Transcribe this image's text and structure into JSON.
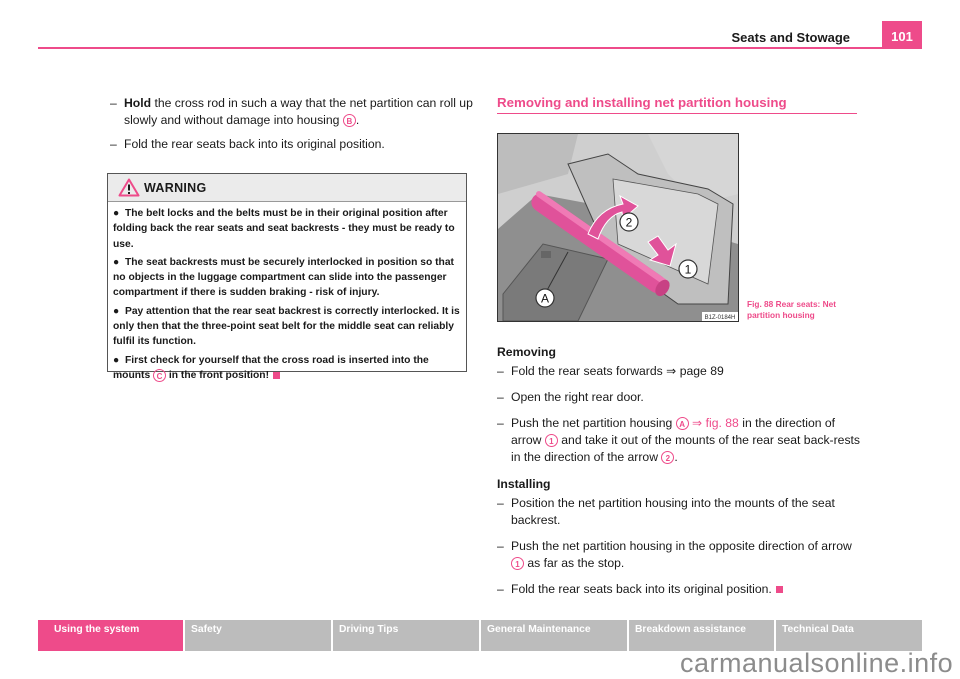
{
  "header": {
    "title": "Seats and Stowage",
    "page_number": "101"
  },
  "left_column": {
    "steps": [
      {
        "bold": "Hold",
        "text_before_badge": " the cross rod in such a way that the net partition can roll up slowly and without damage into housing ",
        "badge": "B",
        "text_after_badge": "."
      },
      {
        "text": "Fold the rear seats back into its original position."
      }
    ],
    "warning": {
      "title": "WARNING",
      "icon": "warning-triangle-icon",
      "items": [
        "The belt locks and the belts must be in their original position after folding back the rear seats and seat backrests - they must be ready to use.",
        "The seat backrests must be securely interlocked in position so that no objects in the luggage compartment can slide into the passenger compartment if there is sudden braking - risk of injury.",
        "Pay attention that the rear seat backrest is correctly interlocked. It is only then that the three-point seat belt for the middle seat can reliably fulfil its function."
      ],
      "last_item": {
        "before": "First check for yourself that the cross road is inserted into the mounts ",
        "badge": "C",
        "after": " in the front position!"
      }
    }
  },
  "right_column": {
    "section_title": "Removing and installing net partition housing",
    "figure": {
      "labels": {
        "a": "A",
        "one": "1",
        "two": "2"
      },
      "code": "B1Z-0184H",
      "caption": "Fig. 88   Rear seats: Net partition housing"
    },
    "removing": {
      "heading": "Removing",
      "step1": "Fold the rear seats forwards ⇒ page 89",
      "step2": "Open the right rear door.",
      "step3": {
        "t1": "Push the net partition housing ",
        "b1": "A",
        "ref": " ⇒ fig. 88",
        "t2": " in the direction of arrow ",
        "b2": "1",
        "t3": " and take it out of the mounts of the rear seat back-rests in the direction of the arrow ",
        "b3": "2",
        "t4": "."
      }
    },
    "installing": {
      "heading": "Installing",
      "step1": "Position the net partition housing into the mounts of the seat backrest.",
      "step2": {
        "t1": "Push the net partition housing in the opposite direction of arrow ",
        "b1": "1",
        "t2": " as far as the stop."
      },
      "step3": "Fold the rear seats back into its original position."
    },
    "dash": "–"
  },
  "footer_nav": [
    {
      "label": "Using the system",
      "active": true
    },
    {
      "label": "Safety",
      "active": false
    },
    {
      "label": "Driving Tips",
      "active": false
    },
    {
      "label": "General Maintenance",
      "active": false
    },
    {
      "label": "Breakdown assistance",
      "active": false
    },
    {
      "label": "Technical Data",
      "active": false
    }
  ],
  "watermark": "carmanualsonline.info",
  "colors": {
    "accent": "#ee4b8a",
    "nav_inactive": "#bcbcbc"
  }
}
